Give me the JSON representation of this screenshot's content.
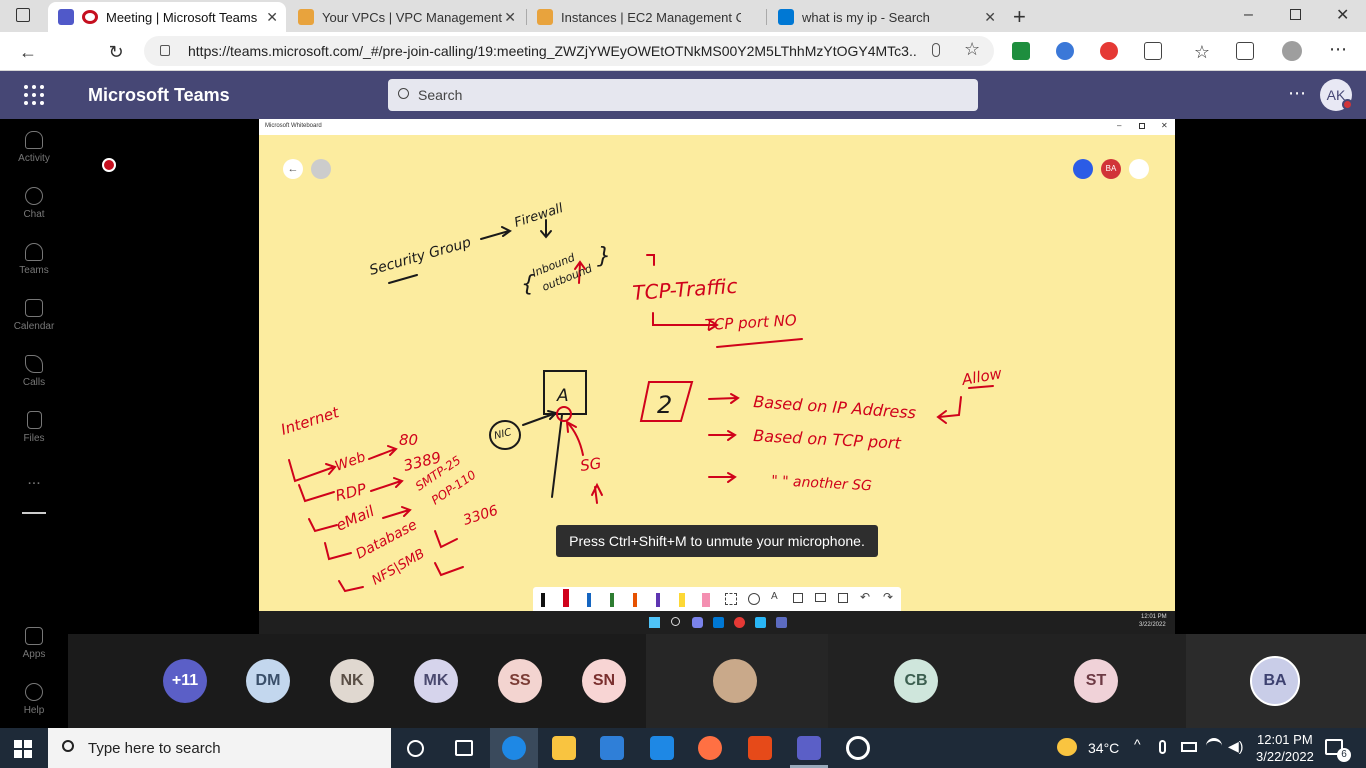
{
  "browser": {
    "tabs": [
      {
        "title": "Meeting | Microsoft Teams",
        "active": true
      },
      {
        "title": "Your VPCs | VPC Management C",
        "active": false
      },
      {
        "title": "Instances | EC2 Management Co",
        "active": false
      },
      {
        "title": "what is my ip - Search",
        "active": false
      }
    ],
    "url": "https://teams.microsoft.com/_#/pre-join-calling/19:meeting_ZWZjYWEyOWEtOTNkMS00Y2M5LThhMzYtOGY4MTc3..."
  },
  "teams": {
    "title": "Microsoft Teams",
    "search_placeholder": "Search",
    "user_initials": "AK",
    "rail": [
      {
        "label": "Activity"
      },
      {
        "label": "Chat"
      },
      {
        "label": "Teams"
      },
      {
        "label": "Calendar"
      },
      {
        "label": "Calls"
      },
      {
        "label": "Files"
      },
      {
        "label": "Apps"
      },
      {
        "label": "Help"
      }
    ],
    "more_label": "..."
  },
  "whiteboard": {
    "window_title": "Microsoft Whiteboard",
    "presence_initials": "BA",
    "clock_time": "12:01 PM",
    "clock_date": "3/22/2022",
    "ink_color": "#d0021b",
    "notes": {
      "security_group": "Security Group",
      "firewall": "Firewall",
      "inbound": "Inbound",
      "outbound": "outbound",
      "tcp_traffic": "TCP-Traffic",
      "tcp_port_no": "TCP port NO",
      "allow": "Allow",
      "box_a": "A",
      "nic": "NIC",
      "sg": "SG",
      "internet": "Internet",
      "web": "Web",
      "web_port": "80",
      "rdp": "RDP",
      "rdp_port": "3389",
      "smtp": "SMTP-25",
      "pop": "POP-110",
      "email": "eMail",
      "database": "Database",
      "db_port": "3306",
      "nfs": "NFS|SMB",
      "number_2": "2",
      "rule_ip": "Based on IP Address",
      "rule_port": "Based on TCP port",
      "rule_sg": "\"  \"  another SG"
    },
    "toast": "Press Ctrl+Shift+M to unmute your microphone."
  },
  "participants": [
    {
      "initials": "+11",
      "bg": "#5b5fc7",
      "fg": "#ffffff"
    },
    {
      "initials": "DM",
      "bg": "#c3d7ee",
      "fg": "#3a4f6a"
    },
    {
      "initials": "NK",
      "bg": "#e0d8d0",
      "fg": "#5a4f46"
    },
    {
      "initials": "MK",
      "bg": "#d6d4ec",
      "fg": "#4b4a70"
    },
    {
      "initials": "SS",
      "bg": "#f3d4d0",
      "fg": "#7b3c35"
    },
    {
      "initials": "SN",
      "bg": "#f8d5d4",
      "fg": "#7a2f2e"
    },
    {
      "initials": "CB",
      "bg": "#cfe6dc",
      "fg": "#3c5f50"
    },
    {
      "initials": "ST",
      "bg": "#f0d2d8",
      "fg": "#6d3a44"
    },
    {
      "initials": "BA",
      "bg": "#c9cde8",
      "fg": "#3d4170"
    }
  ],
  "taskbar": {
    "search_placeholder": "Type here to search",
    "weather": "34°C",
    "time": "12:01 PM",
    "date": "3/22/2022",
    "notifications": "6"
  }
}
